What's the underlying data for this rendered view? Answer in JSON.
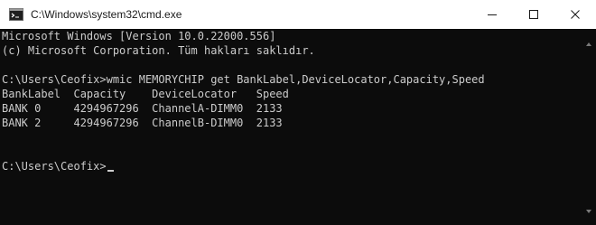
{
  "window": {
    "title": "C:\\Windows\\system32\\cmd.exe",
    "app_icon": "cmd-icon",
    "controls": {
      "minimize_icon": "minimize-icon",
      "maximize_icon": "maximize-icon",
      "close_icon": "close-icon"
    }
  },
  "console": {
    "lines": [
      "Microsoft Windows [Version 10.0.22000.556]",
      "(c) Microsoft Corporation. Tüm hakları saklıdır.",
      "",
      "C:\\Users\\Ceofix>wmic MEMORYCHIP get BankLabel,DeviceLocator,Capacity,Speed",
      "BankLabel  Capacity    DeviceLocator   Speed",
      "BANK 0     4294967296  ChannelA-DIMM0  2133",
      "BANK 2     4294967296  ChannelB-DIMM0  2133",
      "",
      "",
      "C:\\Users\\Ceofix>"
    ]
  },
  "colors": {
    "background": "#0c0c0c",
    "text": "#cccccc",
    "titlebar": "#ffffff"
  }
}
